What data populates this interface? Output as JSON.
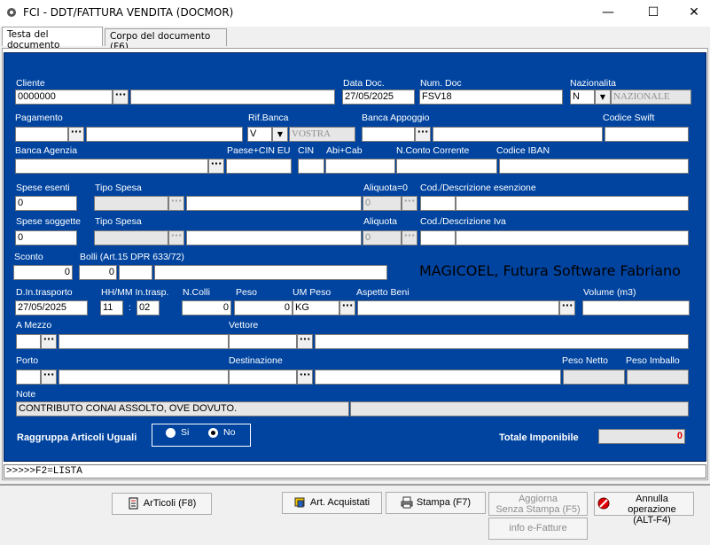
{
  "window": {
    "title": "FCI - DDT/FATTURA VENDITA (DOCMOR)",
    "min": "—",
    "max": "☐",
    "close": "✕"
  },
  "tabs": [
    "Testa del documento",
    "Corpo del documento (F6)"
  ],
  "labels": {
    "cliente": "Cliente",
    "data_doc": "Data Doc.",
    "num_doc": "Num. Doc",
    "nazionalita": "Nazionalita",
    "pagamento": "Pagamento",
    "rif_banca": "Rif.Banca",
    "banca_appoggio": "Banca Appoggio",
    "codice_swift": "Codice Swift",
    "banca_agenzia": "Banca Agenzia",
    "paese_cin": "Paese+CIN EU",
    "cin": "CIN",
    "abi_cab": "Abi+Cab",
    "n_conto": "N.Conto Corrente",
    "codice_iban": "Codice IBAN",
    "spese_esenti": "Spese esenti",
    "tipo_spesa": "Tipo Spesa",
    "aliquota0": "Aliquota=0",
    "cod_desc_esenzione": "Cod./Descrizione esenzione",
    "spese_soggette": "Spese soggette",
    "tipo_spesa2": "Tipo Spesa",
    "aliquota": "Aliquota",
    "cod_desc_iva": "Cod./Descrizione Iva",
    "sconto": "Sconto",
    "bolli": "Bolli (Art.15 DPR 633/72)",
    "d_in_trasporto": "D.In.trasporto",
    "hhmm": "HH/MM In.trasp.",
    "n_colli": "N.Colli",
    "peso": "Peso",
    "um_peso": "UM Peso",
    "aspetto_beni": "Aspetto Beni",
    "volume": "Volume (m3)",
    "a_mezzo": "A Mezzo",
    "vettore": "Vettore",
    "porto": "Porto",
    "destinazione": "Destinazione",
    "peso_netto": "Peso Netto",
    "peso_imballo": "Peso Imballo",
    "note": "Note",
    "raggruppa": "Raggruppa Articoli Uguali",
    "si": "Si",
    "no": "No",
    "totale_imponibile": "Totale Imponibile"
  },
  "values": {
    "cliente": "0000000",
    "data_doc": "27/05/2025",
    "num_doc": "FSV18",
    "naz_code": "N",
    "naz_desc": "NAZIONALE",
    "rif_banca_code": "V",
    "rif_banca_desc": "VOSTRA",
    "spese_esenti": "0",
    "aliquota0": "0",
    "spese_soggette": "0",
    "aliquota": "0",
    "sconto": "0",
    "bolli": "0",
    "d_in_trasporto": "27/05/2025",
    "hh": "11",
    "mm": "02",
    "colon": ":",
    "n_colli": "0",
    "peso": "0",
    "um_peso": "KG",
    "note": "CONTRIBUTO CONAI ASSOLTO, OVE DOVUTO.",
    "totale_imponibile": "0"
  },
  "company_text": "MAGICOEL, Futura Software Fabriano",
  "status": ">>>>>F2=LISTA",
  "buttons": {
    "articoli": "ArTicoli (F8)",
    "art_acquistati": "Art. Acquistati",
    "stampa": "Stampa  (F7)",
    "aggiorna_1": "Aggiorna",
    "aggiorna_2": "Senza Stampa  (F5)",
    "annulla_1": "Annulla operazione",
    "annulla_2": "(ALT-F4)",
    "info": "info e-Fatture"
  },
  "ellipsis": "···",
  "colors": {
    "form_bg": "#0044a0",
    "totale": "#e00000"
  }
}
